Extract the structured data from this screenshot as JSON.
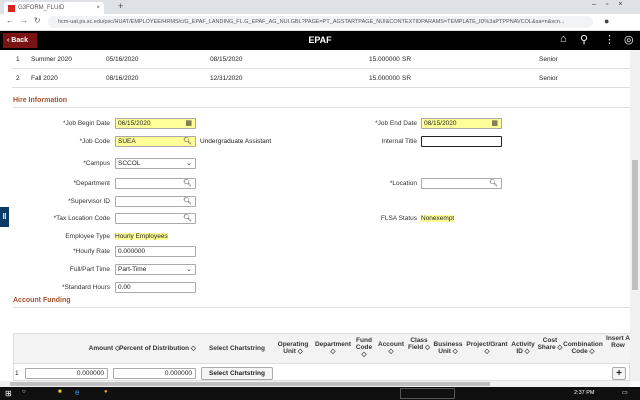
{
  "browser": {
    "tab_title": "G3FORM_FLUID",
    "url": "hcm-uat.ps.sc.edu/psc/HUAT/EMPLOYEE/HRMS/c/G_EPAF_LANDING_FL.G_EPAF_AG_NUI.GBL?PAGE=PT_AGSTARTPAGE_NUI&CONTEXTIDPARAMS=TEMPLATE_ID%3aPTPPNAVCOL&sa=n&scn..."
  },
  "header": {
    "back_label": "Back",
    "title": "EPAF"
  },
  "terms": [
    {
      "num": "1",
      "term": "Summer 2020",
      "begin": "05/16/2020",
      "end": "08/15/2020",
      "units": "15.000000",
      "level": "SR",
      "class": "Senior"
    },
    {
      "num": "2",
      "term": "Fall 2020",
      "begin": "08/16/2020",
      "end": "12/31/2020",
      "units": "15.000000",
      "level": "SR",
      "class": "Senior"
    }
  ],
  "hire": {
    "section_title": "Hire Information",
    "job_begin_label": "*Job Begin Date",
    "job_begin_value": "06/15/2020",
    "job_end_label": "*Job End Date",
    "job_end_value": "08/15/2020",
    "job_code_label": "*Job Code",
    "job_code_value": "SUEA",
    "job_code_desc": "Undergraduate Assistant",
    "internal_title_label": "Internal Title",
    "internal_title_value": "",
    "campus_label": "*Campus",
    "campus_value": "SCCOL",
    "department_label": "*Department",
    "department_value": "",
    "location_label": "*Location",
    "location_value": "",
    "supervisor_label": "*Supervisor ID",
    "supervisor_value": "",
    "tax_location_label": "*Tax Location Code",
    "tax_location_value": "",
    "flsa_label": "FLSA Status",
    "flsa_value": "Nonexempt",
    "employee_type_label": "Employee Type",
    "employee_type_value": "Hourly Employees",
    "hourly_rate_label": "*Hourly Rate",
    "hourly_rate_value": "0.000000",
    "full_part_label": "Full/Part Time",
    "full_part_value": "Part-Time",
    "std_hours_label": "*Standard Hours",
    "std_hours_value": "0.00"
  },
  "funding": {
    "section_title": "Account Funding",
    "columns": [
      "Amount ◇",
      "Percent of Distribution ◇",
      "Select Chartstring",
      "Operating Unit ◇",
      "Department ◇",
      "Fund Code ◇",
      "Account ◇",
      "Class Field ◇",
      "Business Unit ◇",
      "Project/Grant ◇",
      "Activity ID ◇",
      "Cost Share ◇",
      "Combination Code ◇",
      "Insert A Row"
    ],
    "rows": [
      {
        "num": "1",
        "amount": "0.000000",
        "percent": "0.000000",
        "select_label": "Select Chartstring"
      }
    ]
  },
  "taskbar": {
    "time": "2:37 PM"
  }
}
